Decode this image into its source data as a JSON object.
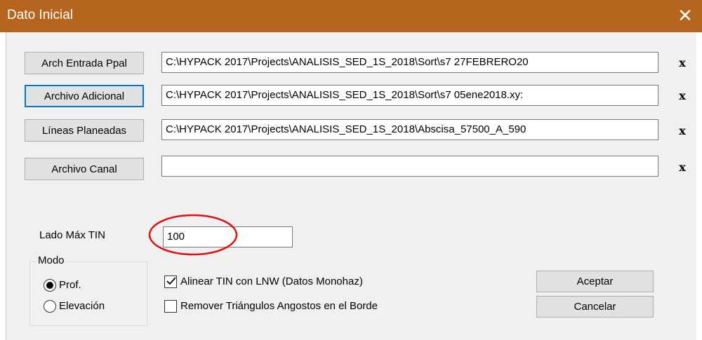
{
  "window": {
    "title": "Dato Inicial",
    "close_glyph": "✕",
    "title_color": "#b5651d"
  },
  "files": [
    {
      "button": "Arch Entrada Ppal",
      "path": "C:\\HYPACK 2017\\Projects\\ANALISIS_SED_1S_2018\\Sort\\s7 27FEBRERO20",
      "clear": "x"
    },
    {
      "button": "Archivo Adicional",
      "path": "C:\\HYPACK 2017\\Projects\\ANALISIS_SED_1S_2018\\Sort\\s7 05ene2018.xy:",
      "clear": "x"
    },
    {
      "button": "Líneas Planeadas",
      "path": "C:\\HYPACK 2017\\Projects\\ANALISIS_SED_1S_2018\\Abscisa_57500_A_590",
      "clear": "x"
    },
    {
      "button": "Archivo Canal",
      "path": "",
      "clear": "x"
    }
  ],
  "tin": {
    "label": "Lado Máx TIN",
    "value": "100",
    "highlight_color": "#e01010"
  },
  "mode": {
    "title": "Modo",
    "options": [
      {
        "label": "Prof.",
        "selected": true
      },
      {
        "label": "Elevación",
        "selected": false
      }
    ]
  },
  "options": {
    "align_tin": {
      "label": "Alinear TIN con LNW (Datos Monohaz)",
      "checked": true
    },
    "remove_triangles": {
      "label": "Remover Triángulos Angostos en el Borde",
      "checked": false
    }
  },
  "actions": {
    "ok": "Aceptar",
    "cancel": "Cancelar"
  }
}
